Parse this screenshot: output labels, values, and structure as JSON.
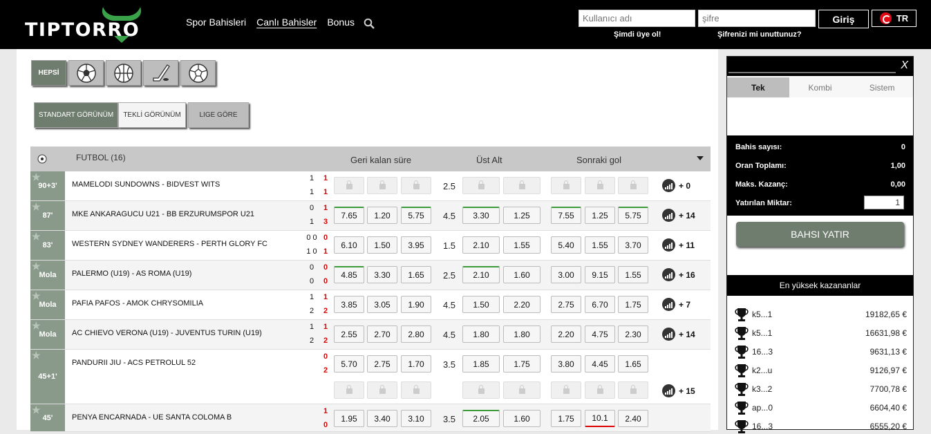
{
  "header": {
    "logo_text": "TIPTORRO",
    "nav": [
      "Spor Bahisleri",
      "Canlı Bahisler",
      "Bonus"
    ],
    "username_placeholder": "Kullanıcı adı",
    "password_placeholder": "şifre",
    "login_label": "Giriş",
    "lang_label": "TR",
    "register_link": "Şimdi üye ol!",
    "forgot_link": "Şifrenizi mi unuttunuz?"
  },
  "filters": {
    "all_label": "HEPSİ",
    "views": [
      "STANDART GÖRÜNÜM",
      "TEKLİ GÖRÜNÜM",
      "LIGE GÖRE"
    ]
  },
  "table": {
    "sport_label": "FUTBOL (16)",
    "col_time": "Geri kalan süre",
    "col_ou": "Üst Alt",
    "col_next": "Sonraki gol"
  },
  "matches": [
    {
      "time": "90+3'",
      "teams": "MAMELODI SUNDOWNS - BIDVEST WITS",
      "s1": "1",
      "s2": "1",
      "r1": "1",
      "r2": "1",
      "odds3": [
        "",
        "",
        ""
      ],
      "line": "2.5",
      "ou": [
        "",
        ""
      ],
      "next": [
        "",
        "",
        ""
      ],
      "more": "+ 0"
    },
    {
      "time": "87'",
      "teams": "MKE ANKARAGUCU U21 - BB ERZURUMSPOR U21",
      "s1": "0",
      "s2": "1",
      "r1": "1",
      "r2": "3",
      "odds3": [
        "7.65",
        "1.20",
        "5.75"
      ],
      "line": "4.5",
      "ou": [
        "3.30",
        "1.25"
      ],
      "next": [
        "7.55",
        "1.25",
        "5.75"
      ],
      "more": "+ 14"
    },
    {
      "time": "83'",
      "teams": "WESTERN SYDNEY WANDERERS - PERTH GLORY FC",
      "s1": "0 0",
      "s2": "1 0",
      "r1": "0",
      "r2": "1",
      "odds3": [
        "6.10",
        "1.50",
        "3.95"
      ],
      "line": "1.5",
      "ou": [
        "2.10",
        "1.55"
      ],
      "next": [
        "5.40",
        "1.55",
        "3.70"
      ],
      "more": "+ 11"
    },
    {
      "time": "Mola",
      "teams": "PALERMO (U19) - AS ROMA (U19)",
      "s1": "0",
      "s2": "0",
      "r1": "0",
      "r2": "0",
      "odds3": [
        "4.85",
        "3.30",
        "1.65"
      ],
      "line": "2.5",
      "ou": [
        "2.10",
        "1.60"
      ],
      "next": [
        "3.00",
        "9.15",
        "1.55"
      ],
      "more": "+ 16"
    },
    {
      "time": "Mola",
      "teams": "PAFIA PAFOS - AMOK CHRYSOMILIA",
      "s1": "1",
      "s2": "2",
      "r1": "1",
      "r2": "2",
      "odds3": [
        "3.85",
        "3.05",
        "1.90"
      ],
      "line": "4.5",
      "ou": [
        "1.50",
        "2.20"
      ],
      "next": [
        "2.75",
        "6.70",
        "1.75"
      ],
      "more": "+ 7"
    },
    {
      "time": "Mola",
      "teams": "AC CHIEVO VERONA (U19) - JUVENTUS TURIN (U19)",
      "s1": "1",
      "s2": "2",
      "r1": "1",
      "r2": "2",
      "odds3": [
        "2.55",
        "2.70",
        "2.80"
      ],
      "line": "4.5",
      "ou": [
        "1.80",
        "1.80"
      ],
      "next": [
        "2.20",
        "4.75",
        "2.30"
      ],
      "more": "+ 14"
    },
    {
      "time": "45+1'",
      "teams": "PANDURII JIU - ACS PETROLUL 52",
      "s1": "",
      "s2": "",
      "r1": "0",
      "r2": "2",
      "odds3": [
        "5.70",
        "2.75",
        "1.70"
      ],
      "line": "3.5",
      "ou": [
        "1.85",
        "1.75"
      ],
      "next": [
        "3.80",
        "4.45",
        "1.65"
      ],
      "more": "+ 15"
    },
    {
      "time": "45'",
      "teams": "PENYA ENCARNADA - UE SANTA COLOMA B",
      "s1": "",
      "s2": "",
      "r1": "1",
      "r2": "0",
      "odds3": [
        "1.95",
        "3.40",
        "3.10"
      ],
      "line": "3.5",
      "ou": [
        "2.05",
        "1.60"
      ],
      "next": [
        "1.75",
        "10.1",
        "2.40"
      ],
      "more": ""
    }
  ],
  "slip": {
    "close_label": "X",
    "tabs": [
      "Tek",
      "Kombi",
      "Sistem"
    ],
    "bet_count_label": "Bahis sayısı:",
    "bet_count": "0",
    "odds_total_label": "Oran Toplamı:",
    "odds_total": "1,00",
    "max_win_label": "Maks. Kazanç:",
    "max_win": "0,00",
    "stake_label": "Yatırılan Miktar:",
    "stake": "1",
    "place_bet_label": "BAHSI YATIR",
    "winners_title": "En yüksek kazananlar",
    "winners": [
      {
        "name": "k5...1",
        "amount": "19182,65 €"
      },
      {
        "name": "k5...1",
        "amount": "16631,98 €"
      },
      {
        "name": "16...3",
        "amount": "9631,13 €"
      },
      {
        "name": "k2...u",
        "amount": "9126,97 €"
      },
      {
        "name": "k3...2",
        "amount": "7700,78 €"
      },
      {
        "name": "ap...0",
        "amount": "6604,40 €"
      },
      {
        "name": "16...3",
        "amount": "6555,20 €"
      }
    ]
  }
}
